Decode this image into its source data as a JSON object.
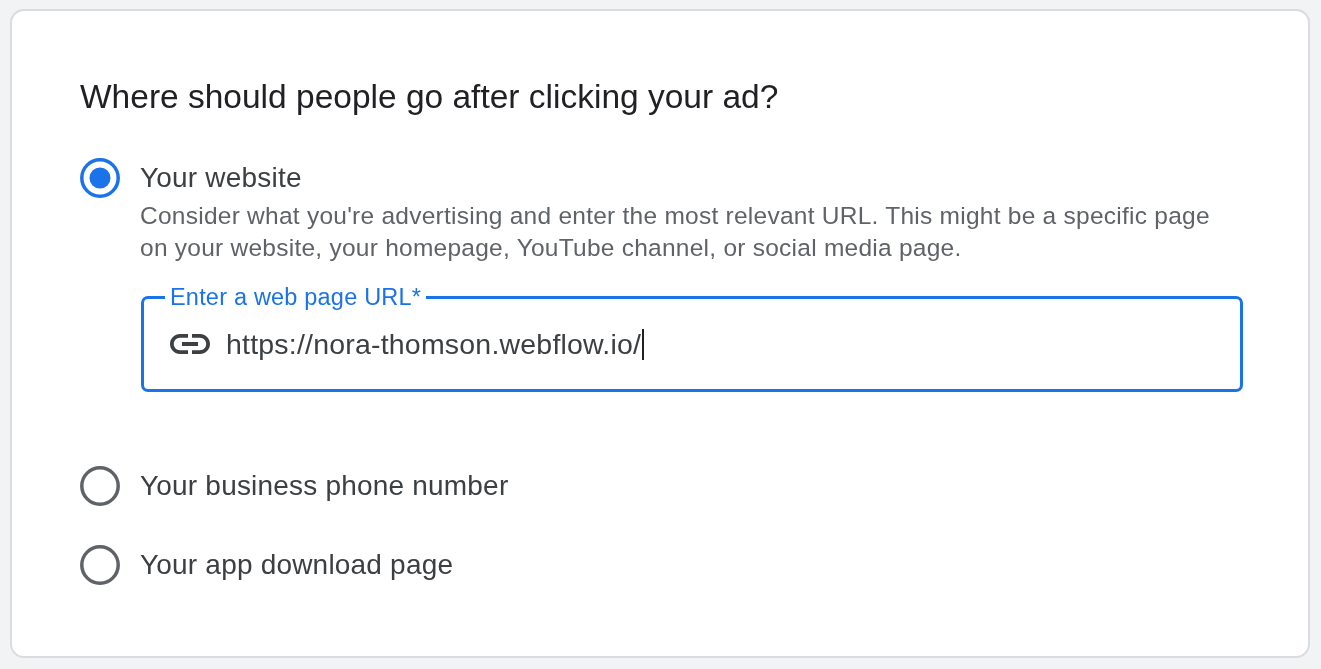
{
  "heading": "Where should people go after clicking your ad?",
  "options": [
    {
      "label": "Your website",
      "selected": true,
      "description": "Consider what you're advertising and enter the most relevant URL. This might be a specific page on your website, your homepage, YouTube channel, or social media page.",
      "url_field": {
        "label": "Enter a web page URL*",
        "value": "https://nora-thomson.webflow.io/",
        "focused": true
      }
    },
    {
      "label": "Your business phone number",
      "selected": false
    },
    {
      "label": "Your app download page",
      "selected": false
    }
  ]
}
